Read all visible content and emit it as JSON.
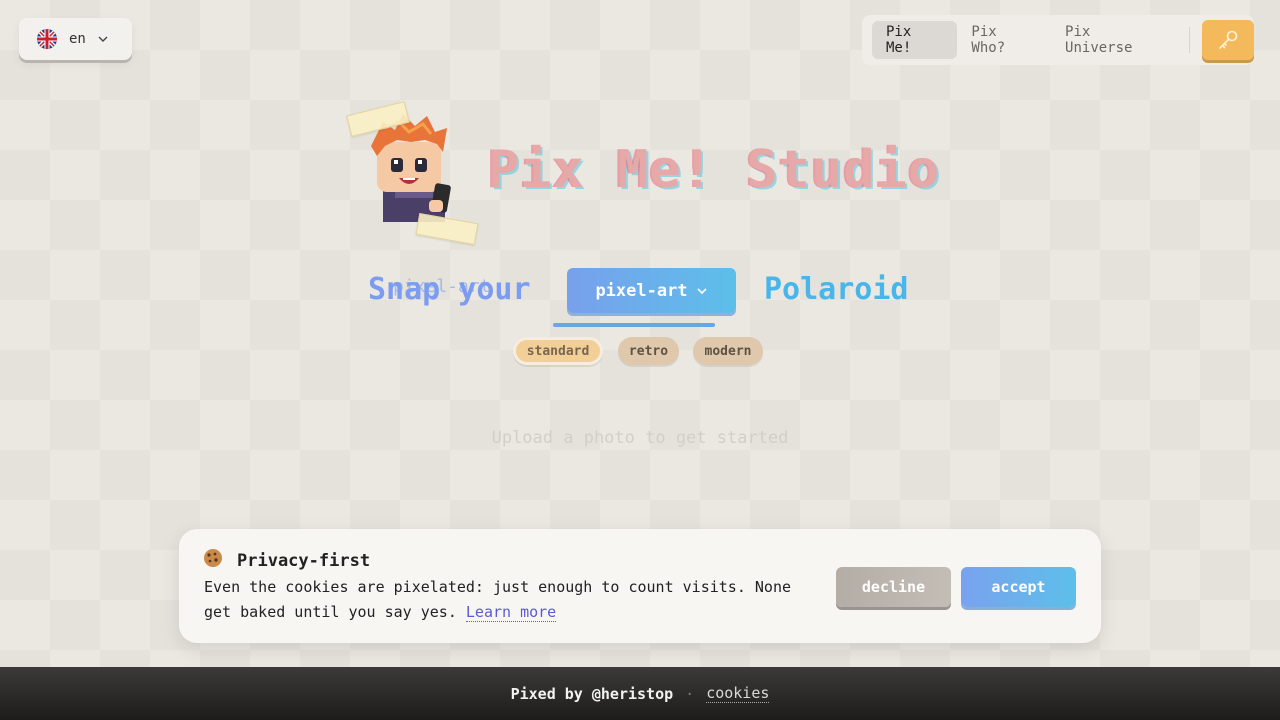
{
  "language": {
    "code": "en",
    "flag": "uk-flag"
  },
  "nav": {
    "items": [
      {
        "label": "Pix Me!",
        "active": true
      },
      {
        "label": "Pix Who?",
        "active": false
      },
      {
        "label": "Pix Universe",
        "active": false
      }
    ],
    "key_button_icon": "key-icon"
  },
  "hero": {
    "title": "Pix Me! Studio",
    "headline_left": "Snap your",
    "headline_ghost": "pixel-art",
    "style_select": "pixel-art",
    "headline_right": "Polaroid",
    "variants": [
      {
        "label": "standard",
        "selected": true
      },
      {
        "label": "retro",
        "selected": false
      },
      {
        "label": "modern",
        "selected": false
      }
    ],
    "upload_hint": "Upload a photo to get started"
  },
  "cookie_banner": {
    "icon": "cookie-icon",
    "title": "Privacy-first",
    "text": "Even the cookies are pixelated: just enough to count visits. None get baked until you say yes.",
    "learn_more": "Learn more",
    "decline": "decline",
    "accept": "accept"
  },
  "footer": {
    "credit": "Pixed by @heristop",
    "separator": "·",
    "cookies_link": "cookies"
  },
  "colors": {
    "accent_blue": "#78a0ec",
    "accent_cyan": "#5cbfea",
    "key_orange": "#f3b95b",
    "chip_selected": "#f2cf97"
  }
}
